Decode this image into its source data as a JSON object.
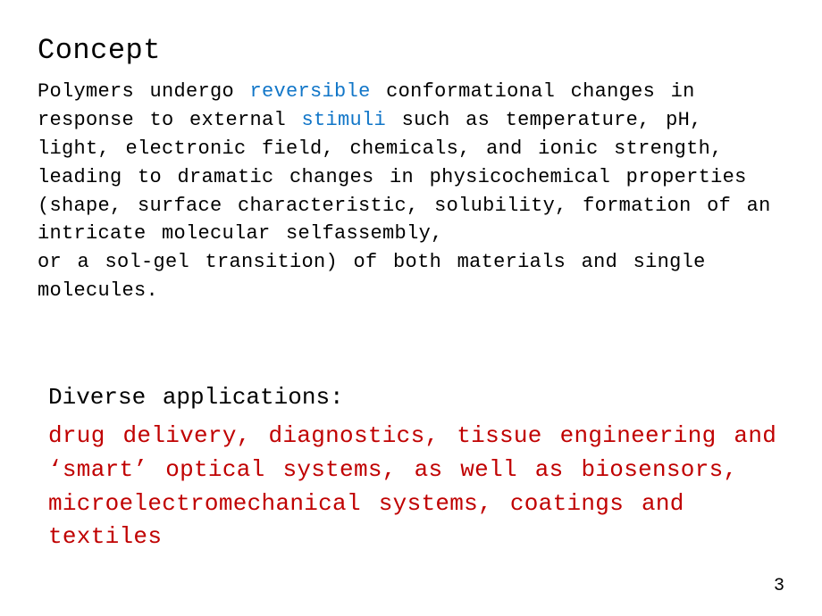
{
  "slide": {
    "title": "Concept",
    "paragraph1": {
      "t0": "Polymers undergo ",
      "blue1": "reversible",
      "t1": " conformational changes in response to external ",
      "blue2": "stimuli",
      "t2": " such as temperature, pH, light, electronic field, chemicals, and ionic strength, leading to dramatic changes in physicochemical properties (shape, surface characteristic, solubility, formation of an intricate molecular selfassembly,",
      "t3": "or a sol-gel transition) of both materials and single molecules."
    },
    "subheading": "Diverse applications:",
    "paragraph2": "drug delivery, diagnostics, tissue engineering and ‘smart’ optical systems, as well as biosensors, microelectromechanical systems, coatings and textiles",
    "page_number": "3"
  }
}
